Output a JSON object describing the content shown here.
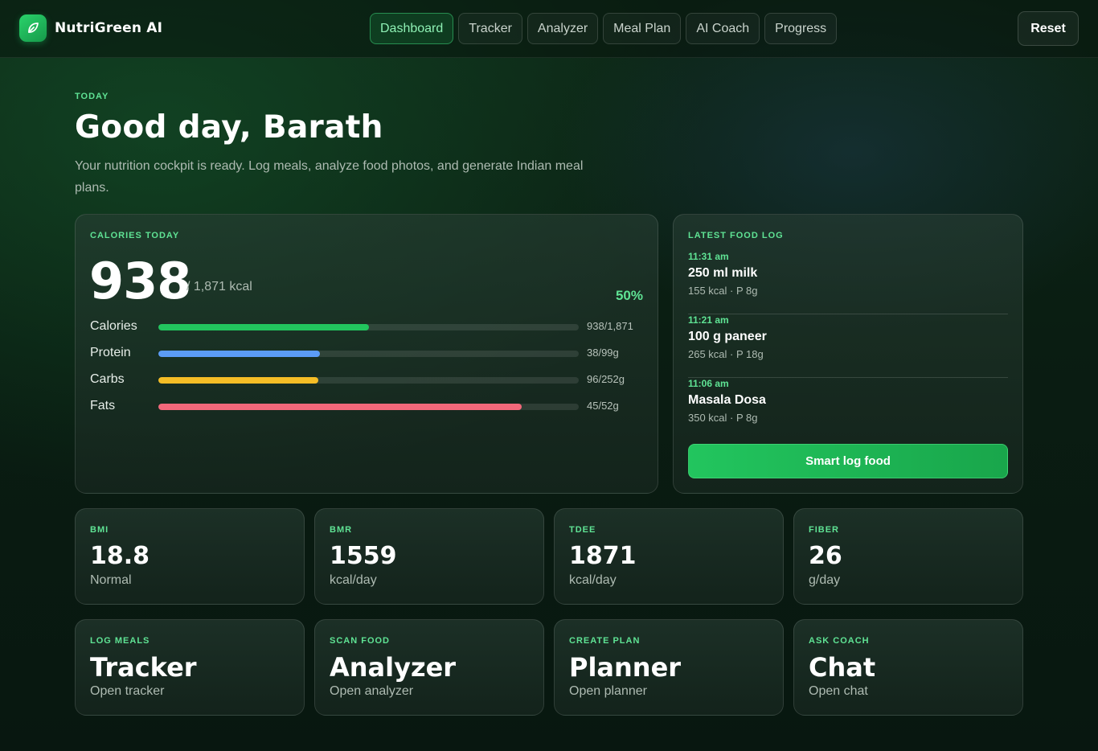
{
  "brand": {
    "name": "NutriGreen AI",
    "logo_icon": "leaf-icon"
  },
  "nav": {
    "tabs": [
      {
        "label": "Dashboard",
        "active": true
      },
      {
        "label": "Tracker",
        "active": false
      },
      {
        "label": "Analyzer",
        "active": false
      },
      {
        "label": "Meal Plan",
        "active": false
      },
      {
        "label": "AI Coach",
        "active": false
      },
      {
        "label": "Progress",
        "active": false
      }
    ],
    "reset_label": "Reset"
  },
  "hero": {
    "eyebrow": "TODAY",
    "title": "Good day, Barath",
    "subtitle": "Your nutrition cockpit is ready. Log meals, analyze food photos, and generate Indian meal plans."
  },
  "calories": {
    "eyebrow": "CALORIES TODAY",
    "consumed": "938",
    "goal_text": "/ 1,871 kcal",
    "percent_text": "50%",
    "macros": [
      {
        "label": "Calories",
        "value_text": "938/1,871",
        "fraction": 0.501,
        "color": "#22c55e"
      },
      {
        "label": "Protein",
        "value_text": "38/99g",
        "fraction": 0.384,
        "color": "#5b9cf6"
      },
      {
        "label": "Carbs",
        "value_text": "96/252g",
        "fraction": 0.381,
        "color": "#f5bd26"
      },
      {
        "label": "Fats",
        "value_text": "45/52g",
        "fraction": 0.865,
        "color": "#f2687a"
      }
    ]
  },
  "food_log": {
    "eyebrow": "LATEST FOOD LOG",
    "items": [
      {
        "time": "11:31 am",
        "name": "250 ml milk",
        "meta": "155 kcal · P 8g"
      },
      {
        "time": "11:21 am",
        "name": "100 g paneer",
        "meta": "265 kcal · P 18g"
      },
      {
        "time": "11:06 am",
        "name": "Masala Dosa",
        "meta": "350 kcal · P 8g"
      }
    ],
    "button_label": "Smart log food"
  },
  "stats": [
    {
      "eyebrow": "BMI",
      "value": "18.8",
      "sub": "Normal"
    },
    {
      "eyebrow": "BMR",
      "value": "1559",
      "sub": "kcal/day"
    },
    {
      "eyebrow": "TDEE",
      "value": "1871",
      "sub": "kcal/day"
    },
    {
      "eyebrow": "FIBER",
      "value": "26",
      "sub": "g/day"
    }
  ],
  "actions": [
    {
      "eyebrow": "LOG MEALS",
      "value": "Tracker",
      "sub": "Open tracker"
    },
    {
      "eyebrow": "SCAN FOOD",
      "value": "Analyzer",
      "sub": "Open analyzer"
    },
    {
      "eyebrow": "CREATE PLAN",
      "value": "Planner",
      "sub": "Open planner"
    },
    {
      "eyebrow": "ASK COACH",
      "value": "Chat",
      "sub": "Open chat"
    }
  ]
}
